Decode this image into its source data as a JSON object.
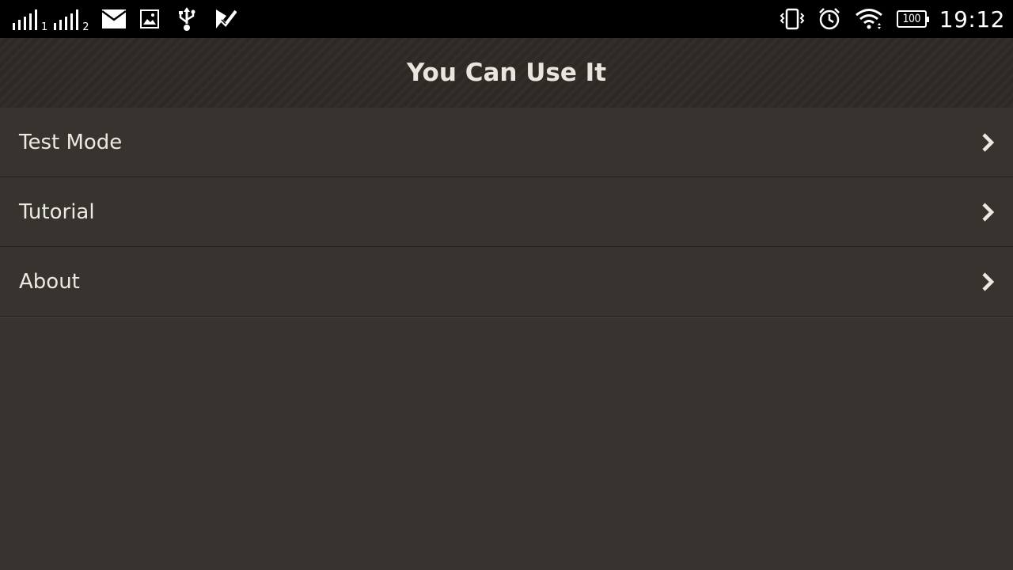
{
  "status_bar": {
    "sim1_label": "1",
    "sim2_label": "2",
    "battery_level": "100",
    "time": "19:12",
    "icons": [
      "signal-icon",
      "signal-icon",
      "mail-icon",
      "image-icon",
      "usb-icon",
      "play-store-icon",
      "vibrate-icon",
      "alarm-icon",
      "wifi-icon",
      "battery-icon"
    ]
  },
  "app_bar": {
    "title": "You Can Use It"
  },
  "menu": {
    "items": [
      {
        "label": "Test Mode"
      },
      {
        "label": "Tutorial"
      },
      {
        "label": "About"
      }
    ]
  },
  "colors": {
    "background": "#37342f",
    "app_bar": "#2d2a26",
    "text": "#ece9e3"
  }
}
